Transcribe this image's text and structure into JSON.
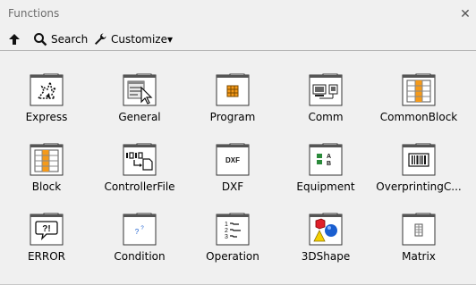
{
  "window": {
    "title": "Functions",
    "close_glyph": "✕"
  },
  "toolbar": {
    "up_icon": "up-arrow-icon",
    "search_label": "Search",
    "customize_label": "Customize▾"
  },
  "palette": {
    "items": [
      {
        "label": "Express",
        "icon": "express-icon"
      },
      {
        "label": "General",
        "icon": "general-icon"
      },
      {
        "label": "Program",
        "icon": "program-icon"
      },
      {
        "label": "Comm",
        "icon": "comm-icon"
      },
      {
        "label": "CommonBlock",
        "icon": "commonblock-icon"
      },
      {
        "label": "Block",
        "icon": "block-icon"
      },
      {
        "label": "ControllerFile",
        "icon": "controllerfile-icon"
      },
      {
        "label": "DXF",
        "icon": "dxf-icon",
        "glyph": "DXF"
      },
      {
        "label": "Equipment",
        "icon": "equipment-icon",
        "glyph": "A\nB"
      },
      {
        "label": "OverprintingC...",
        "icon": "overprinting-icon"
      },
      {
        "label": "ERROR",
        "icon": "error-icon",
        "glyph": "?!"
      },
      {
        "label": "Condition",
        "icon": "condition-icon",
        "glyph": "?"
      },
      {
        "label": "Operation",
        "icon": "operation-icon",
        "glyph": "1\n2\n3"
      },
      {
        "label": "3DShape",
        "icon": "3dshape-icon"
      },
      {
        "label": "Matrix",
        "icon": "matrix-icon"
      }
    ]
  },
  "colors": {
    "orange": "#f59a1a",
    "green": "#2a8a3a",
    "blue": "#1a5fd0",
    "red": "#e0202a",
    "yellow": "#f5d000"
  }
}
